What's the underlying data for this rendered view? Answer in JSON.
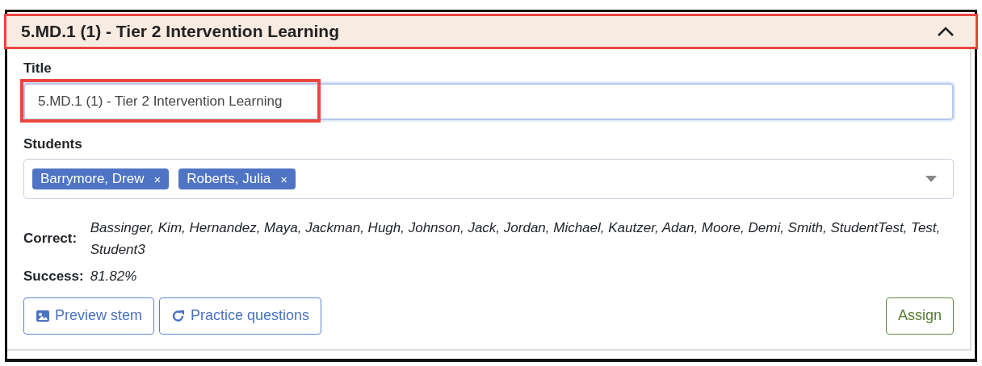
{
  "panel": {
    "title": "5.MD.1 (1) - Tier 2 Intervention Learning",
    "expanded": true,
    "highlighted": true
  },
  "title_field": {
    "label": "Title",
    "value": "5.MD.1 (1) - Tier 2 Intervention Learning",
    "highlighted": true
  },
  "students": {
    "label": "Students",
    "tags": [
      {
        "name": "Barrymore, Drew",
        "remove": "×"
      },
      {
        "name": "Roberts, Julia",
        "remove": "×"
      }
    ]
  },
  "correct": {
    "label": "Correct:",
    "value": "Bassinger, Kim, Hernandez, Maya, Jackman, Hugh, Johnson, Jack, Jordan, Michael, Kautzer, Adan, Moore, Demi, Smith, StudentTest, Test, Student3"
  },
  "success": {
    "label": "Success:",
    "value": "81.82%"
  },
  "buttons": [
    {
      "kind": "image",
      "label": "Preview stem"
    },
    {
      "kind": "refresh",
      "label": "Practice questions"
    },
    {
      "kind": "assign",
      "label": "Assign"
    }
  ]
}
